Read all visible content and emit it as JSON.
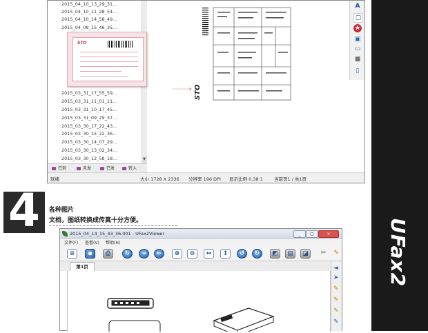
{
  "top_window": {
    "file_rows": [
      "2015_04_10_13_29_31...",
      "2015_04_10_11_28_54...",
      "2015_04_10_14_58_49...",
      "2015_04_08_15_46_35...",
      "2015_03_31_17_55_59...",
      "2015_03_31_11_01_11...",
      "2015_03_31_10_17_45...",
      "2015_03_31_09_29_37...",
      "2015_03_30_17_22_43...",
      "2015_03_30_15_22_36...",
      "2015_03_30_14_07_29...",
      "2015_03_30_13_02_34...",
      "2015_03_30_12_58_18..."
    ],
    "bottom_tabs": [
      "已到",
      "未发",
      "已发",
      "转入"
    ],
    "status": {
      "ready": "就绪",
      "size": "大小 1728 X 2336",
      "resolution": "分辨率 196 DPI",
      "zoom": "显示比例 0.38:1",
      "page": "当前页1 / 共1页"
    },
    "thumb_logo": "STO",
    "preview_logo": "STO"
  },
  "feature": {
    "number": "4",
    "title": "各种图片",
    "description": "文档，图纸转换成传真十分方便。"
  },
  "viewer": {
    "title": "2015_04_14_15_43_36.001 - UFax2Viewer",
    "menu": [
      "文件(F)",
      "查看(V)",
      "帮助(H)"
    ],
    "page_tab": "第1页",
    "window_buttons": [
      "_",
      "□",
      "×"
    ]
  },
  "brand": "UFax2",
  "colors": {
    "banner": "#1a1a1a",
    "accent_red": "#c8323c",
    "toolbar_blue": "#1f5fae"
  }
}
